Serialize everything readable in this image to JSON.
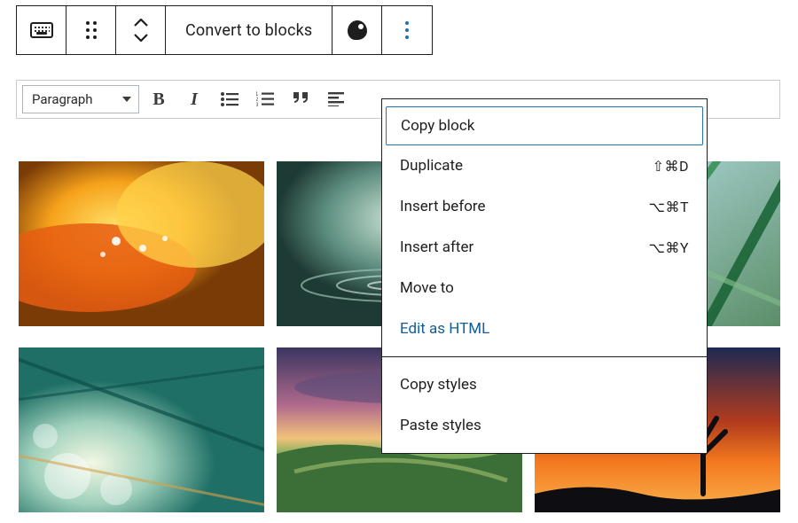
{
  "block_toolbar": {
    "keyboard_icon": "keyboard-icon",
    "drag_icon": "drag-handle-icon",
    "move_up_icon": "chevron-up-icon",
    "move_down_icon": "chevron-down-icon",
    "convert_label": "Convert to blocks",
    "palette_icon": "palette-icon",
    "options_icon": "more-vertical-icon"
  },
  "mce_toolbar": {
    "paragraph_label": "Paragraph",
    "bold_label": "B",
    "italic_label": "I",
    "ul_icon": "bulleted-list-icon",
    "ol_icon": "numbered-list-icon",
    "quote_icon": "blockquote-icon",
    "align_icon": "align-left-icon"
  },
  "menu": {
    "items_a": [
      {
        "label": "Copy block",
        "shortcut": "",
        "selected": true
      },
      {
        "label": "Duplicate",
        "shortcut": "⇧⌘D"
      },
      {
        "label": "Insert before",
        "shortcut": "⌥⌘T"
      },
      {
        "label": "Insert after",
        "shortcut": "⌥⌘Y"
      },
      {
        "label": "Move to",
        "shortcut": ""
      },
      {
        "label": "Edit as HTML",
        "shortcut": "",
        "link": true
      }
    ],
    "items_b": [
      {
        "label": "Copy styles",
        "shortcut": ""
      },
      {
        "label": "Paste styles",
        "shortcut": ""
      }
    ]
  },
  "colors": {
    "accent": "#2271b1",
    "border_dark": "#1e1e1e",
    "border_light": "#c9cdd1"
  }
}
